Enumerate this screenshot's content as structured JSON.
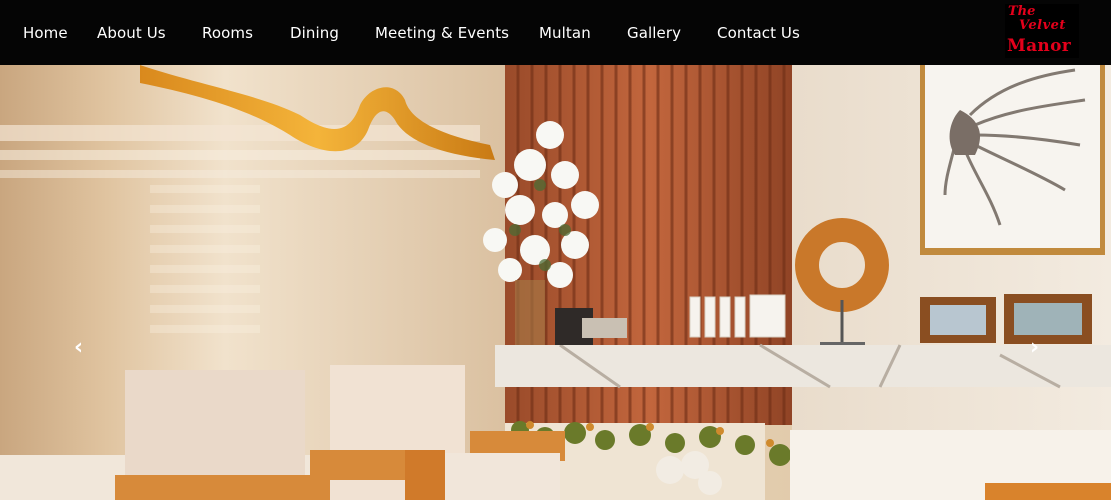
{
  "nav": {
    "items": [
      "Home",
      "About Us",
      "Rooms",
      "Dining",
      "Meeting & Events",
      "Multan",
      "Gallery",
      "Contact Us"
    ]
  },
  "logo": {
    "line1": "The",
    "line2": "Velvet",
    "line3": "Manor"
  },
  "carousel": {
    "prev_icon": "chevron-left-icon",
    "next_icon": "chevron-right-icon",
    "prev_glyph": "‹",
    "next_glyph": "›"
  },
  "colors": {
    "nav_bg": "#050505",
    "logo_red": "#e4001b"
  }
}
